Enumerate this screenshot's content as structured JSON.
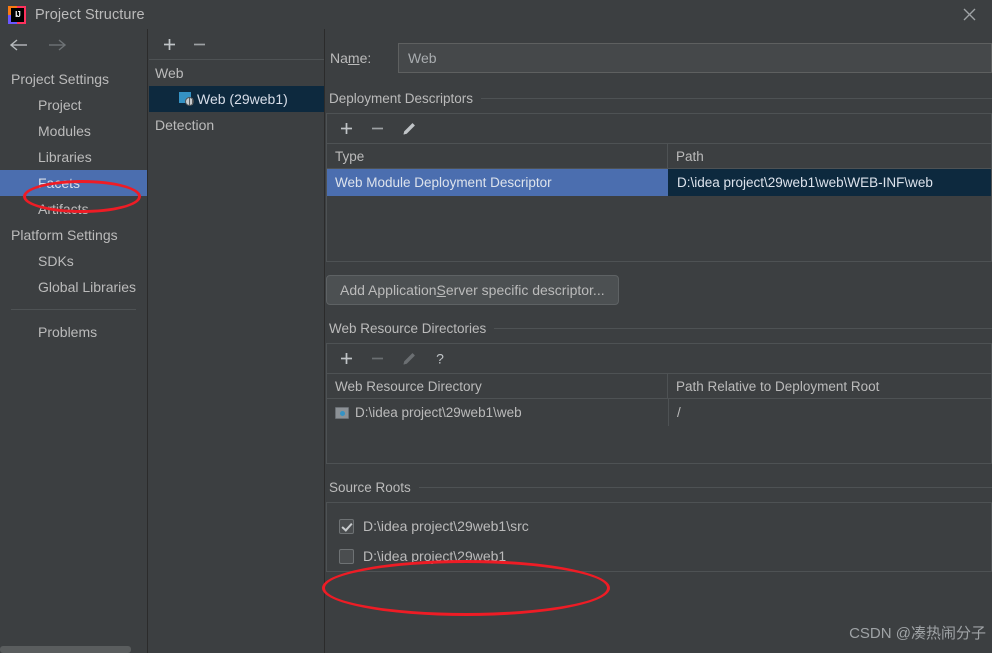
{
  "window": {
    "title": "Project Structure",
    "logo_icon": "intellij-idea-logo",
    "close_icon": "close-icon"
  },
  "sidebar": {
    "back_icon": "arrow-left-icon",
    "forward_icon": "arrow-right-icon",
    "items": [
      {
        "label": "Project Settings",
        "type": "group",
        "selected": false
      },
      {
        "label": "Project",
        "type": "child",
        "selected": false
      },
      {
        "label": "Modules",
        "type": "child",
        "selected": false
      },
      {
        "label": "Libraries",
        "type": "child",
        "selected": false
      },
      {
        "label": "Facets",
        "type": "child",
        "selected": true
      },
      {
        "label": "Artifacts",
        "type": "child",
        "selected": false
      },
      {
        "label": "Platform Settings",
        "type": "group",
        "selected": false
      },
      {
        "label": "SDKs",
        "type": "child",
        "selected": false
      },
      {
        "label": "Global Libraries",
        "type": "child",
        "selected": false
      }
    ],
    "footer_item": {
      "label": "Problems"
    }
  },
  "facets_panel": {
    "toolbar": [
      {
        "icon": "plus-icon",
        "enabled": true
      },
      {
        "icon": "minus-icon",
        "enabled": true
      }
    ],
    "tree": [
      {
        "label": "Web",
        "level": "root",
        "selected": false,
        "icon": null
      },
      {
        "label": "Web (29web1)",
        "level": "child",
        "selected": true,
        "icon": "web-facet-icon"
      },
      {
        "label": "Detection",
        "level": "root",
        "selected": false,
        "icon": null
      }
    ]
  },
  "detail": {
    "name_label_pre": "Na",
    "name_label_mnemonic": "m",
    "name_label_post": "e:",
    "name_value": "Web",
    "name_placeholder": "Name",
    "deployment": {
      "title": "Deployment Descriptors",
      "toolbar": [
        {
          "icon": "plus-icon",
          "enabled": true
        },
        {
          "icon": "minus-icon",
          "enabled": true
        },
        {
          "icon": "pencil-icon",
          "enabled": true
        }
      ],
      "columns": [
        "Type",
        "Path"
      ],
      "rows": [
        {
          "type": "Web Module Deployment Descriptor",
          "path": "D:\\idea project\\29web1\\web\\WEB-INF\\web",
          "selected": true
        }
      ]
    },
    "add_server_button_pre": "Add Application ",
    "add_server_button_mnemonic": "S",
    "add_server_button_post": "erver specific descriptor...",
    "web_resources": {
      "title": "Web Resource Directories",
      "toolbar": [
        {
          "icon": "plus-icon",
          "enabled": true
        },
        {
          "icon": "minus-icon",
          "enabled": false
        },
        {
          "icon": "pencil-icon",
          "enabled": false
        },
        {
          "icon": "question-icon",
          "enabled": true
        }
      ],
      "columns": [
        "Web Resource Directory",
        "Path Relative to Deployment Root"
      ],
      "rows": [
        {
          "directory": "D:\\idea project\\29web1\\web",
          "relative_path": "/",
          "icon": "directory-icon"
        }
      ]
    },
    "source_roots": {
      "title": "Source Roots",
      "rows": [
        {
          "path": "D:\\idea project\\29web1\\src",
          "checked": true
        },
        {
          "path": "D:\\idea project\\29web1",
          "checked": false
        }
      ]
    }
  },
  "annotations": [
    {
      "name": "facets-highlight",
      "shape": "ellipse",
      "color": "#EE1C25"
    },
    {
      "name": "source-roots-highlight",
      "shape": "ellipse",
      "color": "#EE1C25"
    }
  ],
  "watermark": "CSDN @凑热闹分子",
  "theme": {
    "background": "#3C3F41",
    "selection_blue": "#4B6EAF",
    "selection_navy": "#0D293E",
    "text": "#BBBBBB",
    "accent_red": "#EE1C25"
  }
}
